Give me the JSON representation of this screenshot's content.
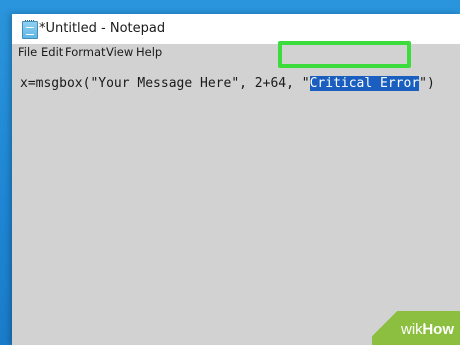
{
  "window": {
    "title": "*Untitled - Notepad",
    "app_icon": "notepad-icon"
  },
  "menu": {
    "items": [
      "File",
      "Edit",
      "Format",
      "View",
      "Help"
    ]
  },
  "editor": {
    "text_before_selection": "x=msgbox(\"Your Message Here\", 2+64, \"",
    "selected_text": "Critical Error",
    "text_after_selection": "\")"
  },
  "watermark": {
    "part1": "wiki",
    "part2": "How"
  },
  "colors": {
    "desktop": "#1e86d4",
    "window_background": "#d2d2d2",
    "selection": "#1a5fbf",
    "highlight_box": "#3ddc3d",
    "watermark": "#8cbf3f"
  }
}
